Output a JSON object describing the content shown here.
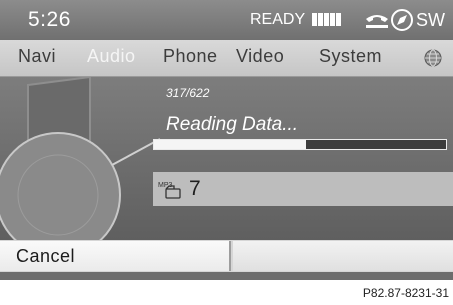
{
  "status": {
    "time": "5:26",
    "ready": "READY",
    "signal_bars": 5,
    "sw_label": "SW"
  },
  "menu": {
    "items": [
      {
        "label": "Navi",
        "active": false
      },
      {
        "label": "Audio",
        "active": true
      },
      {
        "label": "Phone",
        "active": false
      },
      {
        "label": "Video",
        "active": false
      },
      {
        "label": "System",
        "active": false
      }
    ],
    "globe_icon": "globe-icon"
  },
  "media": {
    "track_count": "317/622",
    "status_text": "Reading Data...",
    "progress_fraction": 0.52,
    "track_icon": "mp3-icon",
    "track_icon_text": "MP3",
    "track_number": "7"
  },
  "actions": {
    "cancel_label": "Cancel"
  },
  "reference": "P82.87-8231-31",
  "colors": {
    "frame": "#6d6d6d",
    "menu_bg": "#d0d0d0",
    "active_menu_text": "#f5f5f5"
  }
}
